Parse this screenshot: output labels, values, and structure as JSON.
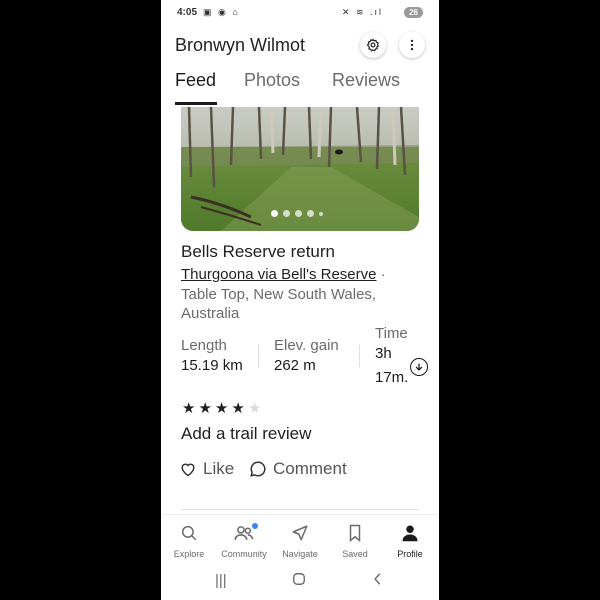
{
  "status_bar": {
    "time": "4:05",
    "battery": "26"
  },
  "header": {
    "title": "Bronwyn Wilmot"
  },
  "tabs": [
    {
      "label": "Feed",
      "active": true
    },
    {
      "label": "Photos",
      "active": false
    },
    {
      "label": "Reviews",
      "active": false
    }
  ],
  "photo": {
    "carousel_index": 1,
    "carousel_count": 5
  },
  "activity": {
    "title": "Bells Reserve return",
    "trail_name": "Thurgoona via Bell's Reserve",
    "location": "Table Top, New South Wales, Australia",
    "separator": "·"
  },
  "stats": {
    "length": {
      "label": "Length",
      "value": "15.19 km"
    },
    "elevation": {
      "label": "Elev. gain",
      "value": "262 m"
    },
    "time": {
      "label": "Time",
      "value_line1": "3h",
      "value_line2": "17m."
    }
  },
  "rating": {
    "value": 4,
    "max": 5
  },
  "review_cta": "Add a trail review",
  "actions": {
    "like": "Like",
    "comment": "Comment"
  },
  "bottom_nav": [
    {
      "label": "Explore",
      "icon": "search-icon",
      "active": false
    },
    {
      "label": "Community",
      "icon": "people-icon",
      "active": false,
      "badge": true
    },
    {
      "label": "Navigate",
      "icon": "navigate-arrow-icon",
      "active": false
    },
    {
      "label": "Saved",
      "icon": "bookmark-icon",
      "active": false
    },
    {
      "label": "Profile",
      "icon": "person-icon",
      "active": true
    }
  ],
  "colors": {
    "badge": "#3b82f6",
    "text": "#1f1f1f",
    "muted": "#6b6b6b"
  }
}
